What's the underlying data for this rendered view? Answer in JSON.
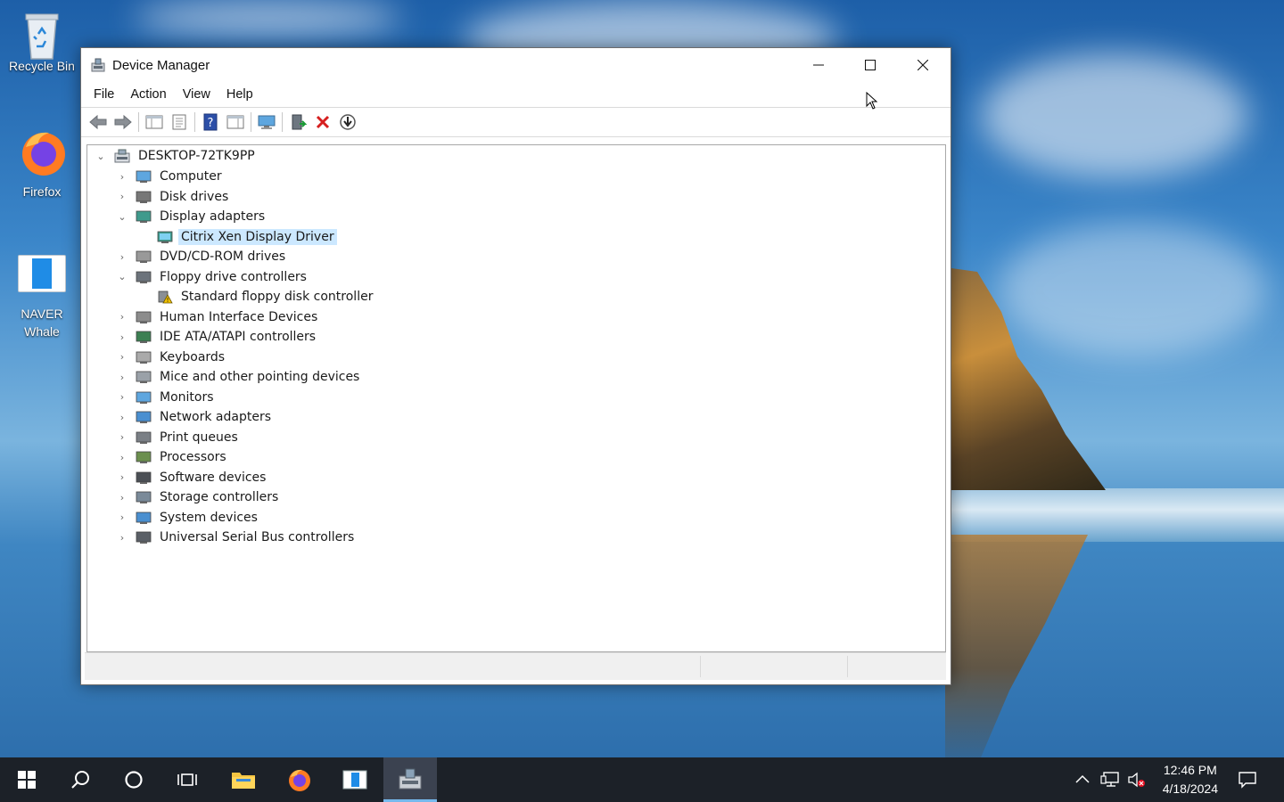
{
  "desktop": {
    "icons": [
      {
        "label": "Recycle Bin"
      },
      {
        "label": "Firefox"
      },
      {
        "label": "NAVER Whale"
      }
    ]
  },
  "window": {
    "title": "Device Manager",
    "menu": [
      "File",
      "Action",
      "View",
      "Help"
    ],
    "toolbar_icons": [
      "back-icon",
      "forward-icon",
      "show-hide-console-tree-icon",
      "properties-icon",
      "help-icon",
      "action-pane-icon",
      "scan-hardware-icon",
      "update-driver-icon",
      "uninstall-device-icon",
      "disable-device-icon"
    ],
    "tree": {
      "root": "DESKTOP-72TK9PP",
      "items": [
        {
          "label": "Computer",
          "state": "collapsed"
        },
        {
          "label": "Disk drives",
          "state": "collapsed"
        },
        {
          "label": "Display adapters",
          "state": "expanded",
          "children": [
            {
              "label": "Citrix Xen Display Driver",
              "selected": true
            }
          ]
        },
        {
          "label": "DVD/CD-ROM drives",
          "state": "collapsed"
        },
        {
          "label": "Floppy drive controllers",
          "state": "expanded",
          "children": [
            {
              "label": "Standard floppy disk controller",
              "warning": true
            }
          ]
        },
        {
          "label": "Human Interface Devices",
          "state": "collapsed"
        },
        {
          "label": "IDE ATA/ATAPI controllers",
          "state": "collapsed"
        },
        {
          "label": "Keyboards",
          "state": "collapsed"
        },
        {
          "label": "Mice and other pointing devices",
          "state": "collapsed"
        },
        {
          "label": "Monitors",
          "state": "collapsed"
        },
        {
          "label": "Network adapters",
          "state": "collapsed"
        },
        {
          "label": "Print queues",
          "state": "collapsed"
        },
        {
          "label": "Processors",
          "state": "collapsed"
        },
        {
          "label": "Software devices",
          "state": "collapsed"
        },
        {
          "label": "Storage controllers",
          "state": "collapsed"
        },
        {
          "label": "System devices",
          "state": "collapsed"
        },
        {
          "label": "Universal Serial Bus controllers",
          "state": "collapsed"
        }
      ]
    }
  },
  "taskbar": {
    "apps": [
      "start-icon",
      "search-icon",
      "cortana-icon",
      "task-view-icon",
      "file-explorer-icon",
      "firefox-icon",
      "naver-whale-icon",
      "device-manager-icon"
    ],
    "active_app": "device-manager-icon",
    "time": "12:46 PM",
    "date": "4/18/2024"
  }
}
